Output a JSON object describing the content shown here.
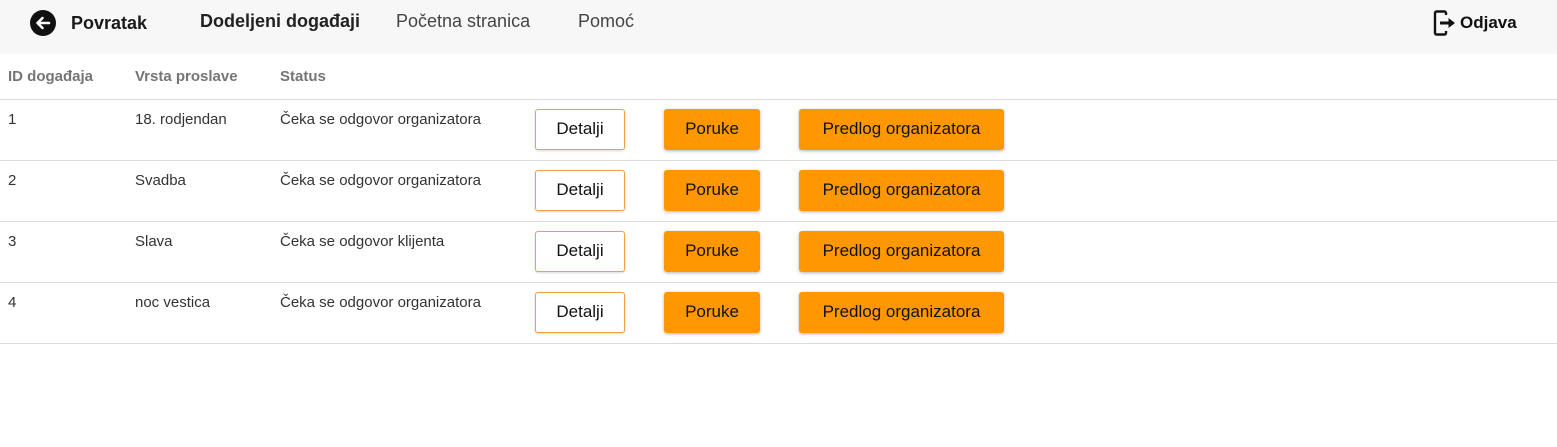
{
  "nav": {
    "back_label": "Povratak",
    "items": [
      {
        "label": "Dodeljeni događaji",
        "active": true
      },
      {
        "label": "Početna stranica",
        "active": false
      },
      {
        "label": "Pomoć",
        "active": false
      }
    ],
    "logout_label": "Odjava",
    "back_icon": "arrow-left-circle-icon",
    "logout_icon": "logout-icon"
  },
  "table": {
    "headers": {
      "id": "ID događaja",
      "type": "Vrsta proslave",
      "status": "Status"
    },
    "rows": [
      {
        "id": "1",
        "type": "18. rodjendan",
        "status": "Čeka se odgovor organizatora"
      },
      {
        "id": "2",
        "type": "Svadba",
        "status": "Čeka se odgovor organizatora"
      },
      {
        "id": "3",
        "type": "Slava",
        "status": "Čeka se odgovor klijenta"
      },
      {
        "id": "4",
        "type": "noc vestica",
        "status": "Čeka se odgovor organizatora"
      }
    ],
    "actions": {
      "details": "Detalji",
      "messages": "Poruke",
      "proposal": "Predlog organizatora"
    }
  },
  "colors": {
    "accent": "#ff9800",
    "outline": "#f0a040",
    "navbar_bg": "#f7f7f7"
  }
}
